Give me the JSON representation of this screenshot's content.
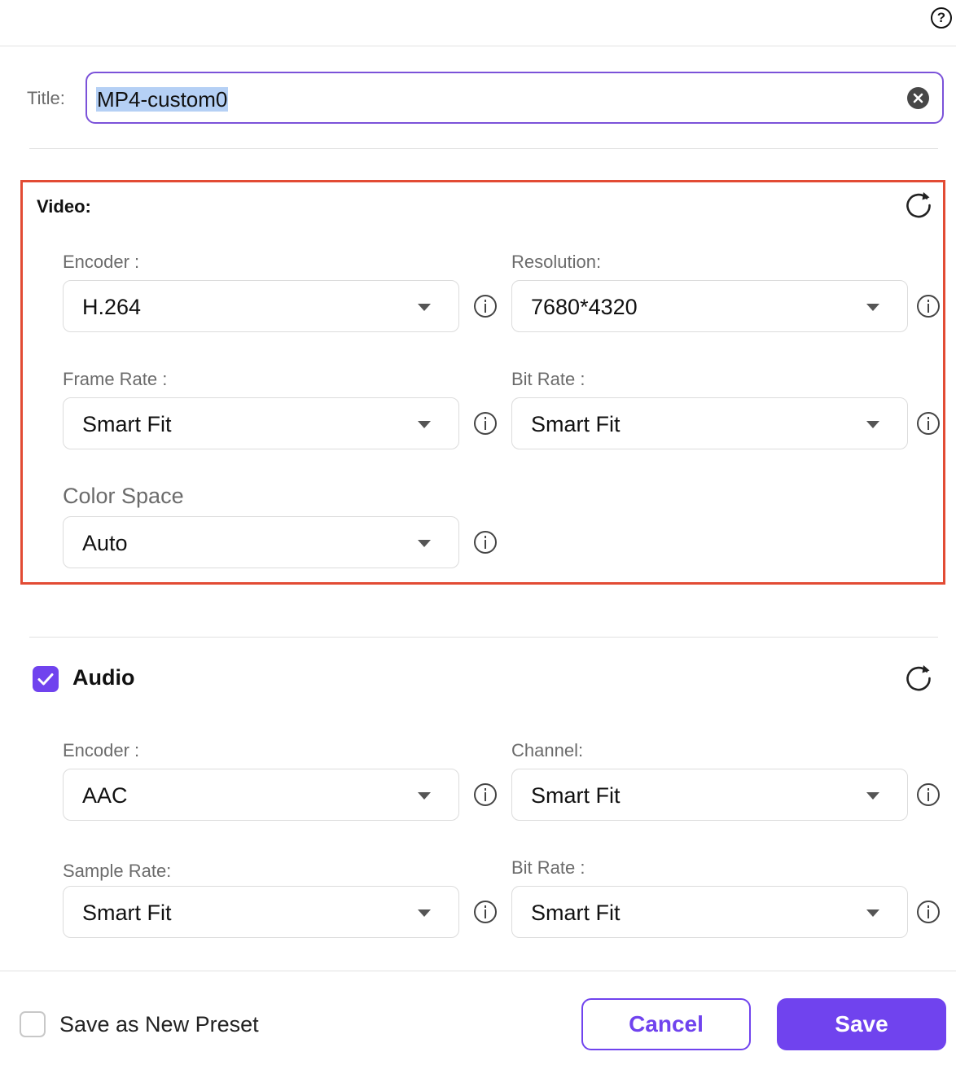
{
  "header": {
    "help_icon": "question-circle-icon",
    "help_glyph": "?"
  },
  "title": {
    "label": "Title:",
    "value": "MP4-custom0"
  },
  "video": {
    "heading": "Video:",
    "encoder": {
      "label": "Encoder :",
      "value": "H.264"
    },
    "resolution": {
      "label": "Resolution:",
      "value": "7680*4320"
    },
    "frame_rate": {
      "label": "Frame Rate :",
      "value": "Smart Fit"
    },
    "bit_rate": {
      "label": "Bit Rate :",
      "value": "Smart Fit"
    },
    "color_space": {
      "label": "Color Space",
      "value": "Auto"
    }
  },
  "audio": {
    "heading": "Audio",
    "enabled": true,
    "encoder": {
      "label": "Encoder :",
      "value": "AAC"
    },
    "channel": {
      "label": "Channel:",
      "value": "Smart Fit"
    },
    "sample_rate": {
      "label": "Sample Rate:",
      "value": "Smart Fit"
    },
    "bit_rate": {
      "label": "Bit Rate :",
      "value": "Smart Fit"
    }
  },
  "footer": {
    "save_preset_label": "Save as New Preset",
    "save_preset_checked": false,
    "cancel_label": "Cancel",
    "save_label": "Save"
  },
  "colors": {
    "accent": "#7043ee",
    "highlight_frame": "#e24b34",
    "selection": "#b5d0f5"
  }
}
